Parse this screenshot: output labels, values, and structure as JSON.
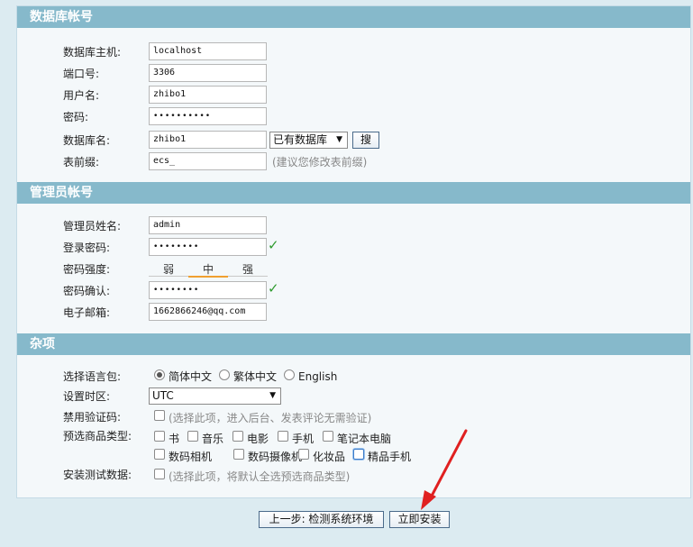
{
  "sections": {
    "database": "数据库帐号",
    "admin": "管理员帐号",
    "misc": "杂项"
  },
  "db": {
    "host_label": "数据库主机:",
    "host_value": "localhost",
    "port_label": "端口号:",
    "port_value": "3306",
    "user_label": "用户名:",
    "user_value": "zhibo1",
    "password_label": "密码:",
    "password_value": "••••••••••",
    "name_label": "数据库名:",
    "name_value": "zhibo1",
    "existing_db_select": "已有数据库",
    "search_button": "搜",
    "prefix_label": "表前缀:",
    "prefix_value": "ecs_",
    "prefix_hint": "(建议您修改表前缀)"
  },
  "admin": {
    "name_label": "管理员姓名:",
    "name_value": "admin",
    "password_label": "登录密码:",
    "password_value": "••••••••",
    "strength_label": "密码强度:",
    "strength_levels": [
      "弱",
      "中",
      "强"
    ],
    "confirm_label": "密码确认:",
    "confirm_value": "••••••••",
    "email_label": "电子邮箱:",
    "email_value": "1662866246@qq.com",
    "check_mark": "✓"
  },
  "misc": {
    "lang_label": "选择语言包:",
    "lang_options": [
      "简体中文",
      "繁体中文",
      "English"
    ],
    "lang_selected": "简体中文",
    "timezone_label": "设置时区:",
    "timezone_value": "UTC",
    "captcha_label": "禁用验证码:",
    "captcha_hint": "(选择此项，进入后台、发表评论无需验证)",
    "goods_type_label": "预选商品类型:",
    "goods_types": [
      "书",
      "音乐",
      "电影",
      "手机",
      "笔记本电脑",
      "数码相机",
      "数码摄像机",
      "化妆品",
      "精品手机"
    ],
    "test_data_label": "安装测试数据:",
    "test_data_hint": "(选择此项，将默认全选预选商品类型)"
  },
  "footer": {
    "back_button": "上一步: 检测系统环境",
    "install_button": "立即安装"
  },
  "colors": {
    "section_header": "#86b9cb",
    "page_bg": "#dcebf1",
    "check": "#2e9b2e",
    "annotation_arrow": "#e02020"
  }
}
